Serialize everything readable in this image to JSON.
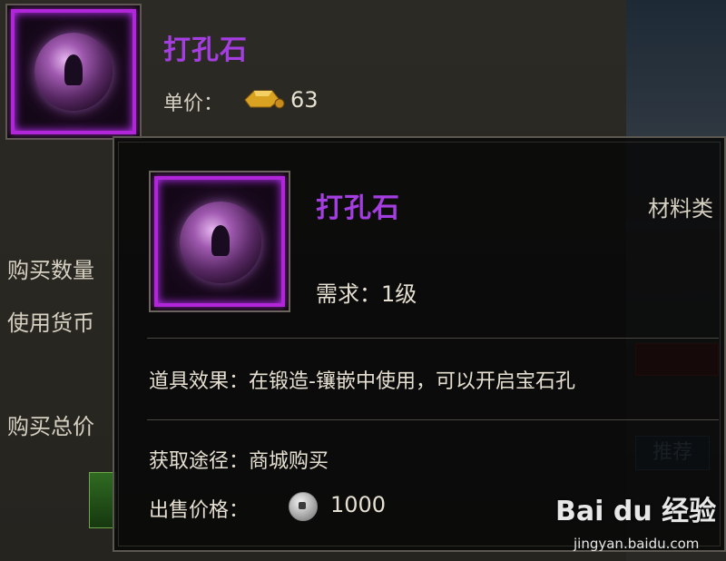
{
  "shop": {
    "item_name": "打孔石",
    "price_label": "单价：",
    "price": "63",
    "currency_icon": "gold-ingot-icon"
  },
  "left_labels": {
    "quantity": "购买数量",
    "currency": "使用货币",
    "total": "购买总价"
  },
  "right_widgets": {
    "recommend": "推荐"
  },
  "tooltip": {
    "item_name": "打孔石",
    "category": "材料类",
    "requirement": "需求：1级",
    "effect": "道具效果：在锻造-镶嵌中使用，可以开启宝石孔",
    "source": "获取途径：商城购买",
    "sell_label": "出售价格：",
    "sell_price": "1000",
    "sell_currency_icon": "silver-coin-icon"
  },
  "watermark": {
    "brand": "Bai du 经验",
    "url": "jingyan.baidu.com"
  },
  "colors": {
    "item_name": "#a43ee0",
    "frame_glow": "#b026d8"
  }
}
